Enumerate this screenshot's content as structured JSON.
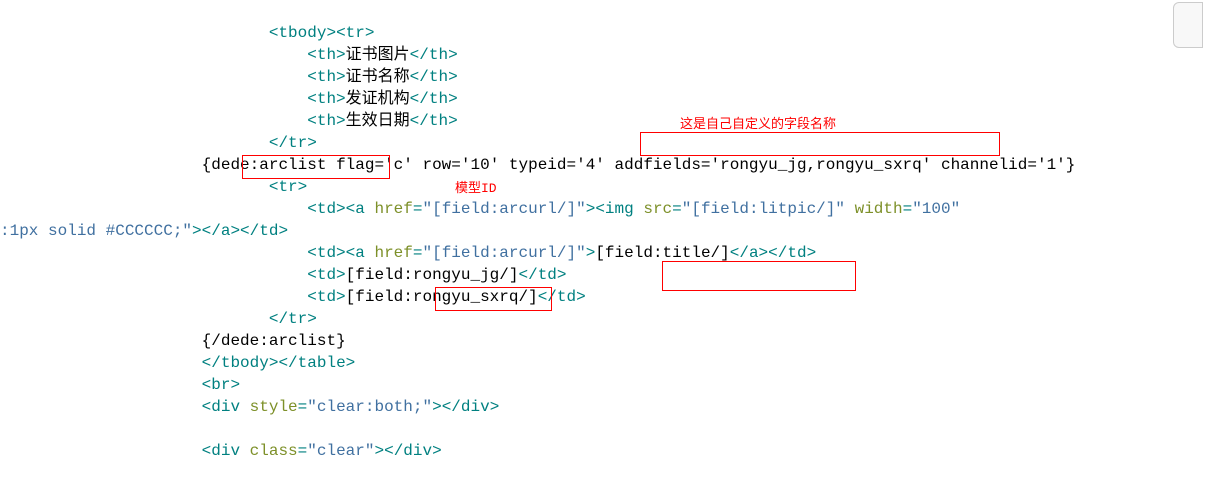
{
  "anno": {
    "fields_label": "这是自己自定义的字段名称",
    "model_label": "模型ID"
  },
  "code": {
    "l01a": "<tbody>",
    "l01b": "<tr>",
    "l02a": "<th>",
    "l02t": "证书图片",
    "l02b": "</th>",
    "l03a": "<th>",
    "l03t": "证书名称",
    "l03b": "</th>",
    "l04a": "<th>",
    "l04t": "发证机构",
    "l04b": "</th>",
    "l05a": "<th>",
    "l05t": "生效日期",
    "l05b": "</th>",
    "l06": "</tr>",
    "l07": "{dede:arclist flag='c' row='10' typeid='4' addfields='rongyu_jg,rongyu_sxrq' channelid='1'}",
    "l08": "<tr>",
    "l09a": "<td>",
    "l09b": "<a",
    "l09c": " href",
    "l09d": "=",
    "l09e": "\"[field:arcurl/]\"",
    "l09f": ">",
    "l09g": "<img",
    "l09h": " src",
    "l09i": "=",
    "l09j": "\"[field:litpic/]\"",
    "l09k": " width",
    "l09l": "=",
    "l09m": "\"100\"",
    "l10a": ":1px solid #CCCCCC;\"",
    "l10b": ">",
    "l10c": "</a>",
    "l10d": "</td>",
    "l11a": "<td>",
    "l11b": "<a",
    "l11c": " href",
    "l11d": "=",
    "l11e": "\"[field:arcurl/]\"",
    "l11f": ">",
    "l11g": "[field:title/]",
    "l11h": "</a>",
    "l11i": "</td>",
    "l12a": "<td>",
    "l12t": "[field:rongyu_jg/]",
    "l12b": "</td>",
    "l13a": "<td>",
    "l13t": "[field:rongyu_sxrq/]",
    "l13b": "</td>",
    "l14": "</tr>",
    "l15": "{/dede:arclist}",
    "l16a": "</tbody>",
    "l16b": "</table>",
    "l17": "<br>",
    "l18a": "<div",
    "l18b": " style",
    "l18c": "=",
    "l18d": "\"clear:both;\"",
    "l18e": ">",
    "l18f": "</div>",
    "l19a": "<div",
    "l19b": " class",
    "l19c": "=",
    "l19d": "\"clear\"",
    "l19e": ">",
    "l19f": "</div>"
  }
}
